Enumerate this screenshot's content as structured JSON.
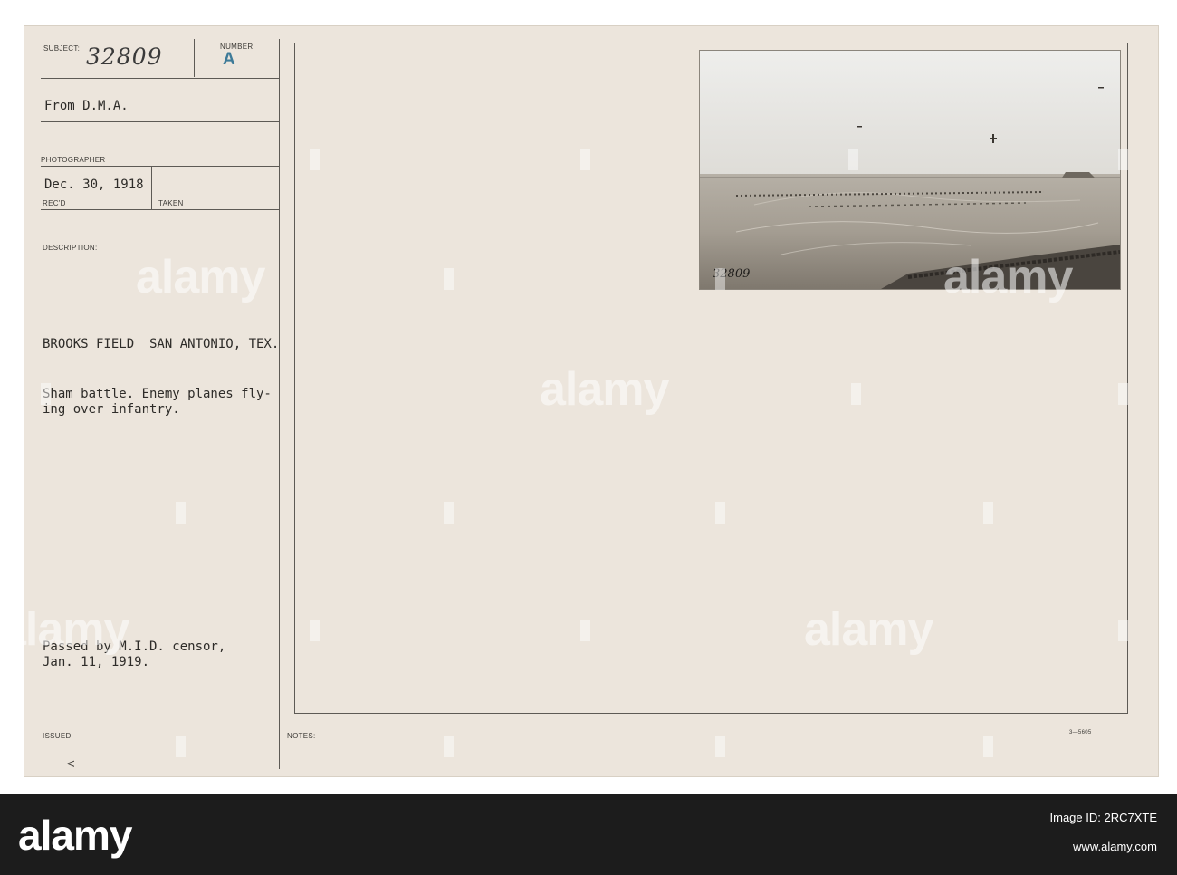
{
  "card": {
    "subject_label": "SUBJECT:",
    "subject_number": "32809",
    "number_label": "NUMBER",
    "number_stamp": "A",
    "from_text": "From D.M.A.",
    "photographer_label": "PHOTOGRAPHER",
    "received_date": "Dec. 30, 1918",
    "recd_label": "REC'D",
    "taken_label": "TAKEN",
    "description_label": "DESCRIPTION:",
    "location": "BROOKS FIELD_ SAN ANTONIO, TEX.",
    "desc_line1": "Sham battle. Enemy planes fly-",
    "desc_line2": "ing over infantry.",
    "censor_line1": "Passed by M.I.D. censor,",
    "censor_line2": "Jan. 11, 1919.",
    "issued_label": "ISSUED",
    "notes_label": "NOTES:",
    "form_code": "3—5605",
    "bottom_mark": "A",
    "photo_inscription": "32809"
  },
  "watermark": {
    "text": "alamy"
  },
  "footer": {
    "logo": "alamy",
    "image_id": "Image ID: 2RC7XTE",
    "url": "www.alamy.com"
  }
}
